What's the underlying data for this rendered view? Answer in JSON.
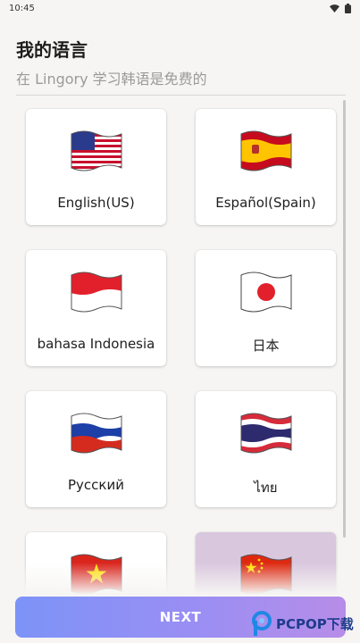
{
  "status_bar": {
    "time": "10:45"
  },
  "header": {
    "title": "我的语言",
    "subtitle": "在 Lingory 学习韩语是免费的"
  },
  "languages": [
    {
      "label": "English(US)",
      "flag": "us-flag-icon"
    },
    {
      "label": "Español(Spain)",
      "flag": "spain-flag-icon"
    },
    {
      "label": "bahasa Indonesia",
      "flag": "indonesia-flag-icon"
    },
    {
      "label": "日本",
      "flag": "japan-flag-icon"
    },
    {
      "label": "Русский",
      "flag": "russia-flag-icon"
    },
    {
      "label": "ไทย",
      "flag": "thailand-flag-icon"
    },
    {
      "label": "",
      "flag": "vietnam-flag-icon"
    },
    {
      "label": "",
      "flag": "china-flag-icon",
      "selected": true
    }
  ],
  "footer": {
    "next_label": "NEXT"
  },
  "watermark": {
    "text": "PCPOP下载"
  },
  "colors": {
    "accent_start": "#7d93f7",
    "accent_end": "#b78de8",
    "selected_card": "#d9c7de"
  }
}
